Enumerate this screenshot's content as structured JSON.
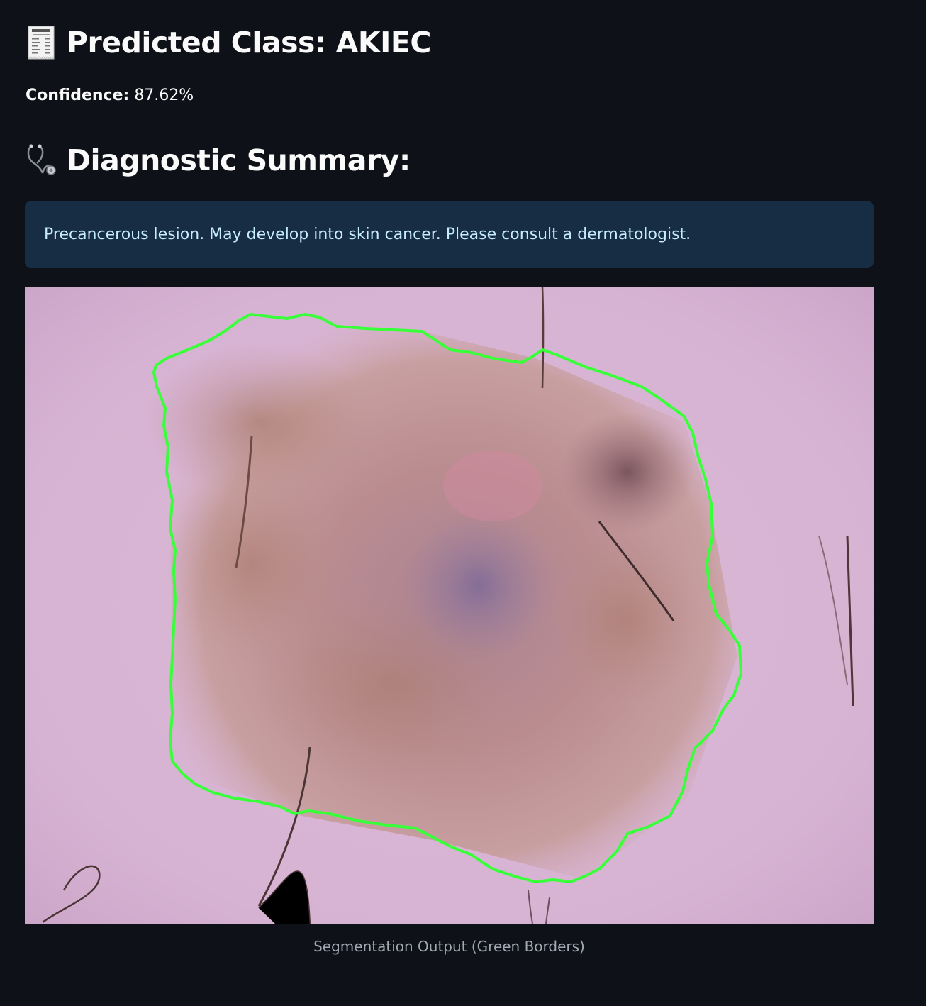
{
  "result": {
    "title_icon": "receipt-icon",
    "title": "Predicted Class: AKIEC",
    "confidence_label": "Confidence:",
    "confidence_value": "87.62%"
  },
  "summary": {
    "title_icon": "stethoscope-icon",
    "title": "Diagnostic Summary:",
    "message": "Precancerous lesion. May develop into skin cancer. Please consult a dermatologist.",
    "accent_color": "#172d43"
  },
  "image": {
    "caption": "Segmentation Output (Green Borders)",
    "border_color": "#39ff3a"
  }
}
